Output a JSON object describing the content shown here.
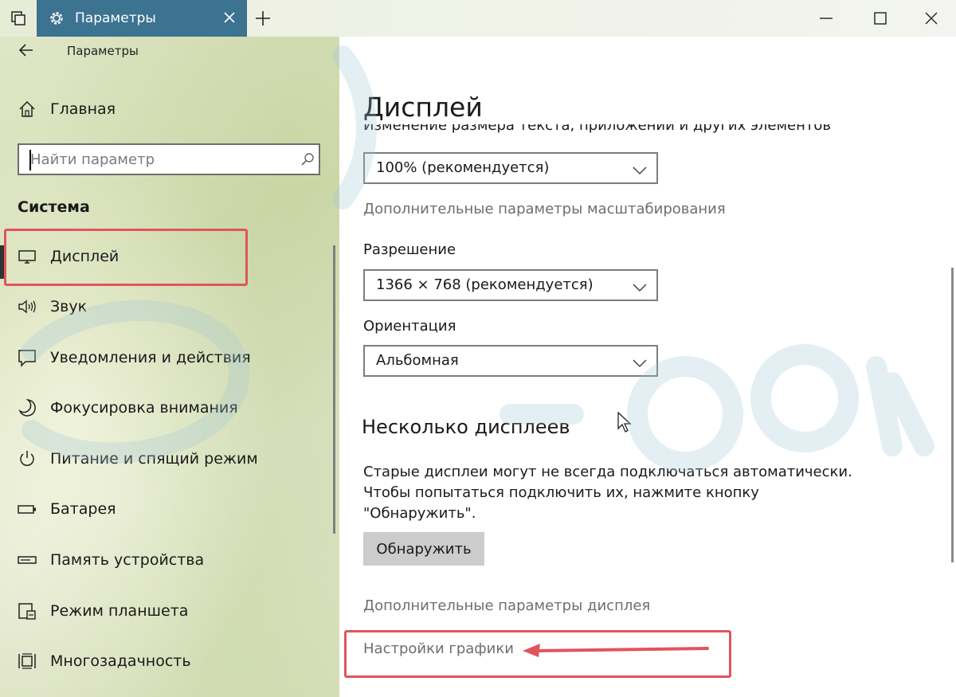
{
  "window": {
    "tab_title": "Параметры",
    "icons": {
      "tab_switcher": "tab-switcher-icon",
      "settings": "gear-icon",
      "close_tab": "close-icon",
      "new_tab": "plus-icon",
      "minimize": "minimize-icon",
      "maximize": "maximize-icon",
      "close_window": "close-icon"
    }
  },
  "sidebar": {
    "app_title": "Параметры",
    "home_label": "Главная",
    "search": {
      "placeholder": "Найти параметр",
      "value": ""
    },
    "section_header": "Система",
    "items": [
      {
        "label": "Дисплей",
        "icon": "monitor-icon",
        "selected": true
      },
      {
        "label": "Звук",
        "icon": "speaker-icon"
      },
      {
        "label": "Уведомления и действия",
        "icon": "notification-icon"
      },
      {
        "label": "Фокусировка внимания",
        "icon": "moon-icon"
      },
      {
        "label": "Питание и спящий режим",
        "icon": "power-icon"
      },
      {
        "label": "Батарея",
        "icon": "battery-icon"
      },
      {
        "label": "Память устройства",
        "icon": "storage-icon"
      },
      {
        "label": "Режим планшета",
        "icon": "tablet-icon"
      },
      {
        "label": "Многозадачность",
        "icon": "multitasking-icon"
      }
    ]
  },
  "content": {
    "title": "Дисплей",
    "cut_label": "Изменение размера текста, приложений и других элементов",
    "scale": {
      "value": "100% (рекомендуется)"
    },
    "advanced_scaling_link": "Дополнительные параметры масштабирования",
    "resolution": {
      "label": "Разрешение",
      "value": "1366 × 768 (рекомендуется)"
    },
    "orientation": {
      "label": "Ориентация",
      "value": "Альбомная"
    },
    "multiple_displays": {
      "title": "Несколько дисплеев",
      "description": [
        "Старые дисплеи могут не всегда подключаться автоматически.",
        "Чтобы попытаться подключить их, нажмите кнопку",
        "\"Обнаружить\"."
      ],
      "detect_button": "Обнаружить"
    },
    "advanced_display_link": "Дополнительные параметры дисплея",
    "graphics_settings_link": "Настройки графики"
  },
  "annotation": {
    "highlight_color": "#e0555d"
  },
  "colors": {
    "accent_tab": "#3b7391",
    "link_gray": "#6e6e6e",
    "button_gray": "#cccccc"
  }
}
